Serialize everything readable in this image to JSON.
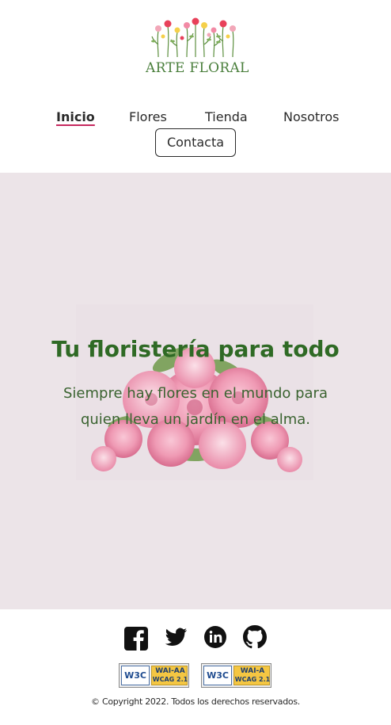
{
  "brand": {
    "name": "ARTE FLORAL"
  },
  "nav": {
    "items": [
      {
        "label": "Inicio",
        "active": true
      },
      {
        "label": "Flores",
        "active": false
      },
      {
        "label": "Tienda",
        "active": false
      },
      {
        "label": "Nosotros",
        "active": false
      }
    ],
    "contact_label": "Contacta"
  },
  "hero": {
    "title": "Tu floristería para todo",
    "subtitle": "Siempre hay flores en el mundo para quien lleva un jardín en el alma."
  },
  "footer": {
    "social": [
      "facebook-icon",
      "twitter-icon",
      "linkedin-icon",
      "github-icon"
    ],
    "badges": [
      {
        "w3c": "W3C",
        "level": "WAI-AA",
        "standard": "WCAG 2.1"
      },
      {
        "w3c": "W3C",
        "level": "WAI-A",
        "standard": "WCAG 2.1"
      }
    ],
    "copyright": "© Copyright 2022. Todos los derechos reservados."
  },
  "colors": {
    "accent": "#c6285e",
    "green": "#2f6a25",
    "hero_bg": "#ece4e8"
  }
}
